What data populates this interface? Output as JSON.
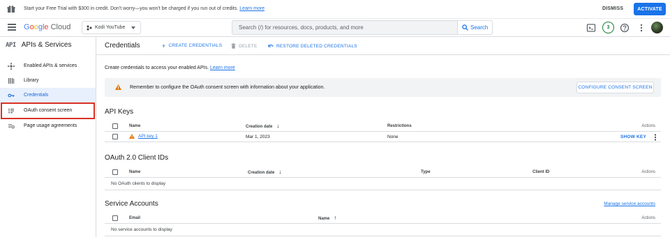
{
  "promo": {
    "message": "Start your Free Trial with $300 in credit. Don't worry—you won't be charged if you run out of credits.",
    "learn_more": "Learn more",
    "dismiss": "DISMISS",
    "activate": "ACTIVATE"
  },
  "header": {
    "logo_google": [
      "G",
      "o",
      "o",
      "g",
      "l",
      "e"
    ],
    "logo_cloud": "Cloud",
    "project": "Kodi YouTube",
    "search_placeholder": "Search (/) for resources, docs, products, and more",
    "search_button": "Search",
    "notification_count": "3"
  },
  "sidebar": {
    "api_badge": "API",
    "title": "APIs & Services",
    "items": [
      {
        "label": "Enabled APIs & services",
        "icon": "hub-icon"
      },
      {
        "label": "Library",
        "icon": "library-icon"
      },
      {
        "label": "Credentials",
        "icon": "key-icon",
        "active": true
      },
      {
        "label": "OAuth consent screen",
        "icon": "consent-icon"
      },
      {
        "label": "Page usage agreements",
        "icon": "settings-list-icon"
      }
    ]
  },
  "toolbar": {
    "title": "Credentials",
    "create": "CREATE CREDENTIALS",
    "delete": "DELETE",
    "restore": "RESTORE DELETED CREDENTIALS"
  },
  "intro": {
    "text": "Create credentials to access your enabled APIs.",
    "link": "Learn more"
  },
  "warning": {
    "text": "Remember to configure the OAuth consent screen with information about your application.",
    "button": "CONFIGURE CONSENT SCREEN"
  },
  "api_keys": {
    "title": "API Keys",
    "columns": [
      "Name",
      "Creation date",
      "Restrictions",
      "Actions"
    ],
    "rows": [
      {
        "name": "API key 1",
        "date": "Mar 1, 2023",
        "restrictions": "None",
        "action": "SHOW KEY"
      }
    ]
  },
  "oauth": {
    "title": "OAuth 2.0 Client IDs",
    "columns": [
      "Name",
      "Creation date",
      "Type",
      "Client ID",
      "Actions"
    ],
    "empty": "No OAuth clients to display"
  },
  "service_accounts": {
    "title": "Service Accounts",
    "manage_link": "Manage service accounts",
    "columns": [
      "Email",
      "Name",
      "Actions"
    ],
    "empty": "No service accounts to display"
  },
  "colors": {
    "accent": "#1a73e8",
    "warning": "#e37400",
    "highlight_border": "#d93025",
    "active_bg": "#e8f0fe"
  }
}
